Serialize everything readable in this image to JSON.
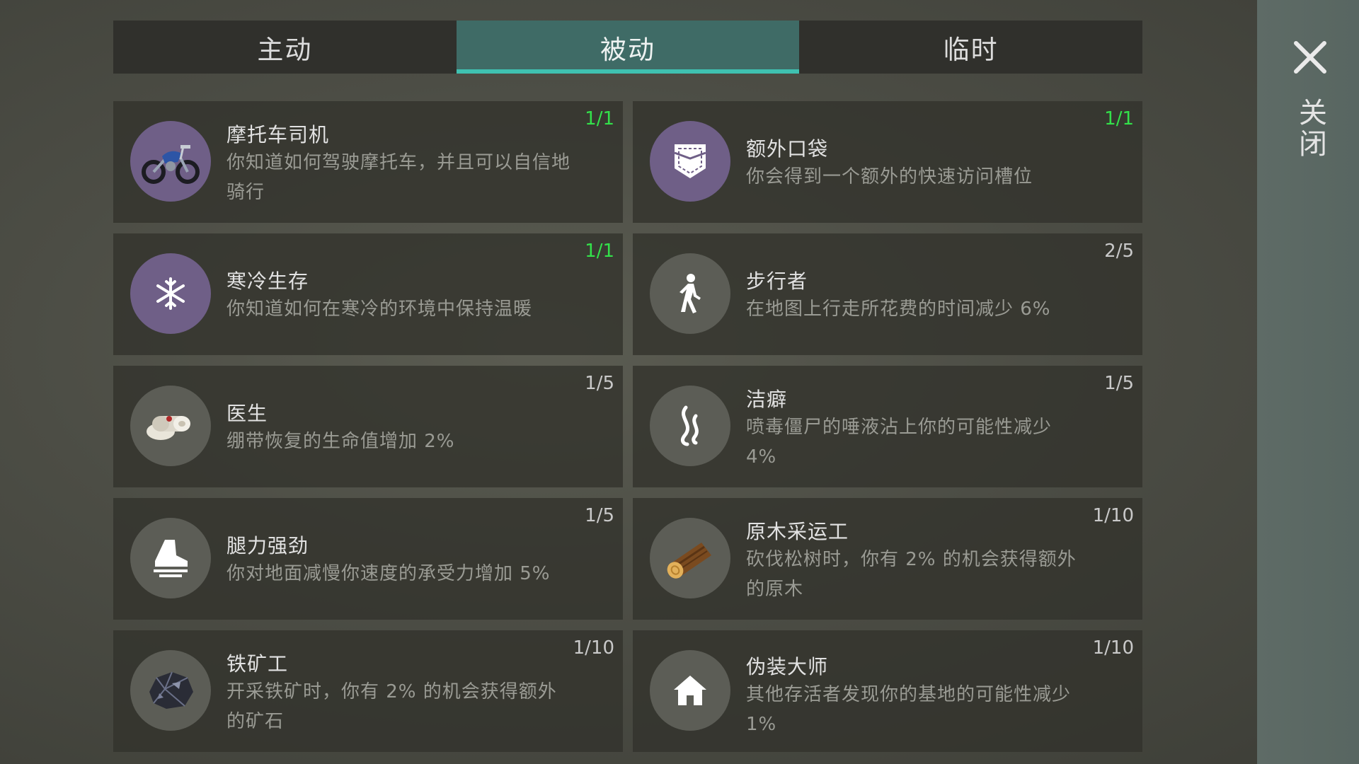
{
  "tabs": [
    {
      "label": "主动",
      "active": false
    },
    {
      "label": "被动",
      "active": true
    },
    {
      "label": "临时",
      "active": false
    }
  ],
  "close": {
    "label": "关闭",
    "icon": "close-icon"
  },
  "colors": {
    "tab_active": "#3f6b66",
    "tab_underline": "#3fc1b1",
    "count_complete": "#33e14a",
    "icon_purple": "#6f5f87"
  },
  "perks": [
    {
      "title": "摩托车司机",
      "desc": "你知道如何驾驶摩托车，并且可以自信地骑行",
      "count": "1/1",
      "icon": "motorcycle-icon"
    },
    {
      "title": "额外口袋",
      "desc": "你会得到一个额外的快速访问槽位",
      "count": "1/1",
      "icon": "pocket-icon"
    },
    {
      "title": "寒冷生存",
      "desc": "你知道如何在寒冷的环境中保持温暖",
      "count": "1/1",
      "icon": "snowflake-icon"
    },
    {
      "title": "步行者",
      "desc": "在地图上行走所花费的时间减少 6%",
      "count": "2/5",
      "icon": "walker-icon"
    },
    {
      "title": "医生",
      "desc": "绷带恢复的生命值增加 2%",
      "count": "1/5",
      "icon": "bandage-icon"
    },
    {
      "title": "洁癖",
      "desc": "喷毒僵尸的唾液沾上你的可能性减少 4%",
      "count": "1/5",
      "icon": "fumes-icon"
    },
    {
      "title": "腿力强劲",
      "desc": "你对地面减慢你速度的承受力增加 5%",
      "count": "1/5",
      "icon": "boot-icon"
    },
    {
      "title": "原木采运工",
      "desc": "砍伐松树时，你有 2% 的机会获得额外的原木",
      "count": "1/10",
      "icon": "log-icon"
    },
    {
      "title": "铁矿工",
      "desc": "开采铁矿时，你有 2% 的机会获得额外的矿石",
      "count": "1/10",
      "icon": "iron-ore-icon"
    },
    {
      "title": "伪装大师",
      "desc": "其他存活者发现你的基地的可能性减少 1%",
      "count": "1/10",
      "icon": "house-icon"
    }
  ]
}
